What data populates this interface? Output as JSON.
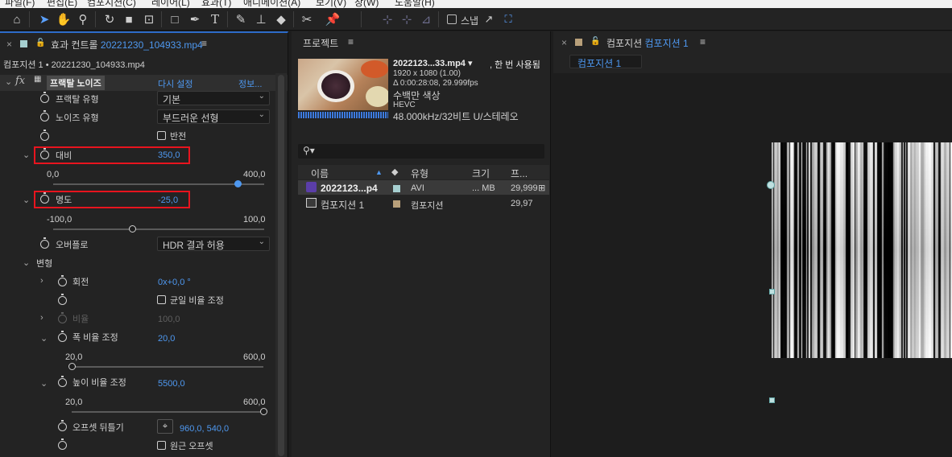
{
  "menu": [
    "파일(F)",
    "편집(E)",
    "컴포지션(C)",
    "레이어(L)",
    "효과(T)",
    "애니메이션(A)",
    "보기(V)",
    "창(W)",
    "도움말(H)"
  ],
  "toolbar": {
    "tools": [
      "home-icon",
      "selection-icon",
      "hand-icon",
      "zoom-icon",
      "rotate-icon",
      "camera-icon",
      "pan-behind-icon",
      "rectangle-icon",
      "pen-icon",
      "type-icon",
      "brush-icon",
      "clone-stamp-icon",
      "eraser-icon",
      "roto-brush-icon",
      "puppet-pin-icon"
    ],
    "snap_label": "스냅"
  },
  "effect_controls": {
    "tab_title": "효과 컨트롤",
    "tab_file": "20221230_104933.mp4",
    "breadcrumb": "컴포지션 1 • 20221230_104933.mp4",
    "effect_name": "프랙탈 노이즈",
    "reset_label": "다시 설정",
    "about_label": "정보...",
    "fx_label": "fx",
    "fractal_type_label": "프랙탈 유형",
    "fractal_type_value": "기본",
    "noise_type_label": "노이즈 유형",
    "noise_type_value": "부드러운 선형",
    "invert_label": "반전",
    "contrast_label": "대비",
    "contrast_value": "350,0",
    "contrast_min": "0,0",
    "contrast_max": "400,0",
    "contrast_fraction": 0.875,
    "brightness_label": "명도",
    "brightness_value": "-25,0",
    "brightness_min": "-100,0",
    "brightness_max": "100,0",
    "brightness_fraction": 0.375,
    "overflow_label": "오버플로",
    "overflow_value": "HDR 결과 허용",
    "transform_label": "변형",
    "rotation_label": "회전",
    "rotation_value": "0x+0,0 °",
    "uniform_scale_label": "균일 비율 조정",
    "scale_label": "비율",
    "scale_value": "100,0",
    "scale_width_label": "폭 비율 조정",
    "scale_width_value": "20,0",
    "scale_width_min": "20,0",
    "scale_width_max": "600,0",
    "scale_width_fraction": 0.0,
    "scale_height_label": "높이 비율 조정",
    "scale_height_value": "5500,0",
    "scale_height_min": "20,0",
    "scale_height_max": "600,0",
    "scale_height_fraction": 1.0,
    "offset_label": "오프셋 뒤틀기",
    "offset_value": "960,0, 540,0",
    "perspective_label": "원근 오프셋"
  },
  "project": {
    "tab_title": "프로젝트",
    "item_name": "2022123...33.mp4 ▾",
    "item_usage": ", 한 번 사용됨",
    "item_resolution": "1920 x 1080 (1.00)",
    "item_duration": "Δ 0:00:28:08, 29.999fps",
    "item_colors": "수백만 색상",
    "item_codec": "HEVC",
    "item_audio": "48.000kHz/32비트 U/스테레오",
    "search_placeholder": "",
    "columns": {
      "name": "이름",
      "type": "유형",
      "size": "크기",
      "fps": "프..."
    },
    "rows": [
      {
        "name": "2022123...p4",
        "type": "AVI",
        "size": "... MB",
        "fps": "29,999",
        "label_color": "#a6cfd0"
      },
      {
        "name": "컴포지션 1",
        "type": "컴포지션",
        "size": "",
        "fps": "29,97",
        "label_color": "#b8a07a"
      }
    ]
  },
  "composition": {
    "tab_prefix": "컴포지션",
    "tab_name": "컴포지션 1",
    "viewer_tab": "컴포지션 1"
  },
  "colors": {
    "accent": "#4e98f0",
    "highlight": "#e8141e",
    "panel_bg": "#232323",
    "comp_swatch": "#b8a07a",
    "footage_swatch": "#a6cfd0"
  }
}
